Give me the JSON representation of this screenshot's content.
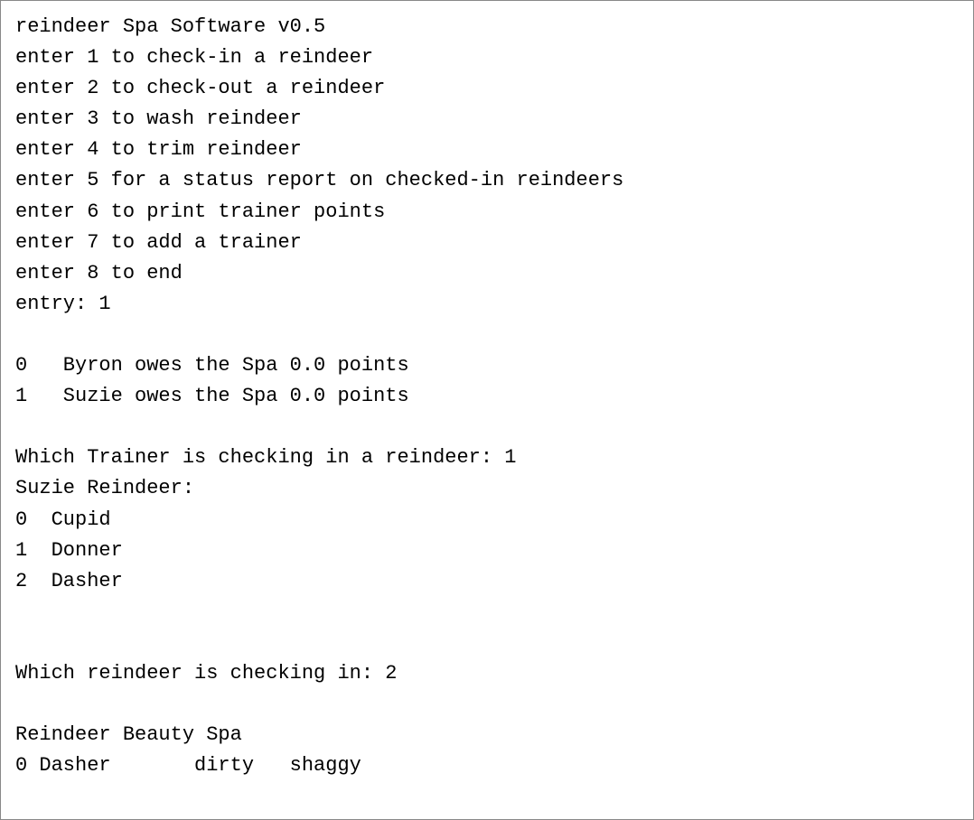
{
  "lines": [
    "reindeer Spa Software v0.5",
    "enter 1 to check-in a reindeer",
    "enter 2 to check-out a reindeer",
    "enter 3 to wash reindeer",
    "enter 4 to trim reindeer",
    "enter 5 for a status report on checked-in reindeers",
    "enter 6 to print trainer points",
    "enter 7 to add a trainer",
    "enter 8 to end",
    "entry: 1",
    "",
    "0   Byron owes the Spa 0.0 points",
    "1   Suzie owes the Spa 0.0 points",
    "",
    "Which Trainer is checking in a reindeer: 1",
    "Suzie Reindeer:",
    "0  Cupid",
    "1  Donner",
    "2  Dasher",
    "",
    "",
    "Which reindeer is checking in: 2",
    "",
    "Reindeer Beauty Spa",
    "0 Dasher       dirty   shaggy"
  ]
}
